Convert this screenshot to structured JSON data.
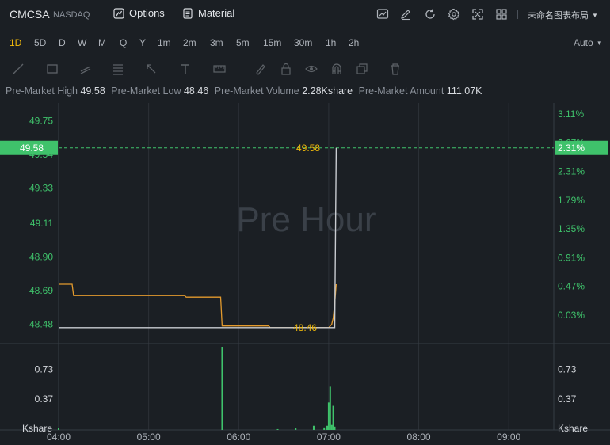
{
  "header": {
    "symbol": "CMCSA",
    "exchange": "NASDAQ",
    "options_label": "Options",
    "material_label": "Material",
    "layout_name": "未命名图表布局",
    "icons": [
      "chart-icon",
      "edit-icon",
      "refresh-icon",
      "settings-icon",
      "fullscreen-icon",
      "layout-grid-icon"
    ]
  },
  "periods": {
    "items": [
      "1D",
      "5D",
      "D",
      "W",
      "M",
      "Q",
      "Y",
      "1m",
      "2m",
      "3m",
      "5m",
      "15m",
      "30m",
      "1h",
      "2h"
    ],
    "active": "1D",
    "scale_mode": "Auto"
  },
  "stats": {
    "high_label": "Pre-Market High",
    "high_value": "49.58",
    "low_label": "Pre-Market Low",
    "low_value": "48.46",
    "volume_label": "Pre-Market Volume",
    "volume_value": "2.28Kshare",
    "amount_label": "Pre-Market Amount",
    "amount_value": "111.07K"
  },
  "chart_data": {
    "type": "line",
    "watermark": "Pre Hour",
    "x_ticks": [
      "04:00",
      "05:00",
      "06:00",
      "07:00",
      "08:00",
      "09:00"
    ],
    "x_range_hours": [
      4.0,
      9.5
    ],
    "price_ylim": [
      48.37,
      49.86
    ],
    "left_ticks": [
      "49.75",
      "49.54",
      "49.33",
      "49.11",
      "48.90",
      "48.69",
      "48.48"
    ],
    "right_ticks": [
      "3.11%",
      "2.67%",
      "2.31%",
      "1.79%",
      "1.35%",
      "0.91%",
      "0.47%",
      "0.03%"
    ],
    "current_price": "49.58",
    "current_pct": "2.31%",
    "annotation_high": "49.58",
    "annotation_low": "48.46",
    "price_series": [
      {
        "t": "04:00",
        "v": 48.46
      },
      {
        "t": "07:04",
        "v": 48.46
      },
      {
        "t": "07:05",
        "v": 49.58
      }
    ],
    "avg_series": [
      {
        "t": "04:00",
        "v": 48.73
      },
      {
        "t": "04:09",
        "v": 48.73
      },
      {
        "t": "04:10",
        "v": 48.66
      },
      {
        "t": "05:24",
        "v": 48.66
      },
      {
        "t": "05:25",
        "v": 48.65
      },
      {
        "t": "05:48",
        "v": 48.65
      },
      {
        "t": "05:49",
        "v": 48.47
      },
      {
        "t": "06:20",
        "v": 48.47
      },
      {
        "t": "06:21",
        "v": 48.46
      },
      {
        "t": "07:00",
        "v": 48.46
      },
      {
        "t": "07:02",
        "v": 48.48
      },
      {
        "t": "07:03",
        "v": 48.52
      },
      {
        "t": "07:04",
        "v": 48.61
      },
      {
        "t": "07:05",
        "v": 48.73
      }
    ],
    "volume_unit": "Kshare",
    "volume_ticks": [
      "0.73",
      "0.37"
    ],
    "volume_ylim": [
      0,
      1.0
    ],
    "volume_bars": [
      {
        "t": "04:00",
        "v": 0.02
      },
      {
        "t": "05:49",
        "v": 1.0
      },
      {
        "t": "06:26",
        "v": 0.01
      },
      {
        "t": "06:38",
        "v": 0.02
      },
      {
        "t": "06:50",
        "v": 0.05
      },
      {
        "t": "06:57",
        "v": 0.03
      },
      {
        "t": "06:59",
        "v": 0.05
      },
      {
        "t": "07:00",
        "v": 0.33
      },
      {
        "t": "07:01",
        "v": 0.52
      },
      {
        "t": "07:02",
        "v": 0.06
      },
      {
        "t": "07:03",
        "v": 0.29
      },
      {
        "t": "07:04",
        "v": 0.04
      }
    ],
    "colors": {
      "price_line": "#c9ccd1",
      "avg_line": "#e39a2d",
      "up": "#3fc26b",
      "annotation": "#f0b90b",
      "grid": "#2c3138"
    }
  }
}
